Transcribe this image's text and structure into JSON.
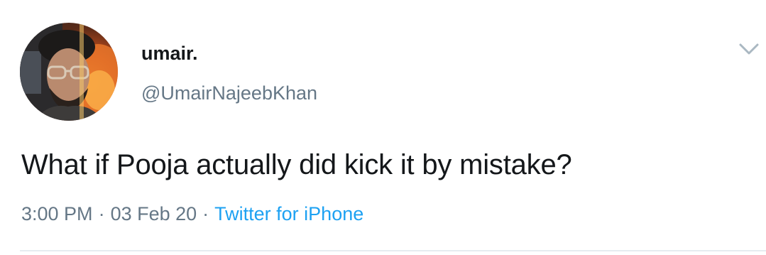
{
  "user": {
    "display_name": "umair.",
    "handle": "@UmairNajeebKhan",
    "avatar_icon": "profile-photo"
  },
  "tweet": {
    "text": "What if Pooja actually did kick it by mistake?",
    "time": "3:00 PM",
    "separator": "·",
    "date": "03 Feb 20",
    "source": "Twitter for iPhone"
  },
  "menu": {
    "icon": "chevron-down-icon"
  },
  "colors": {
    "text": "#14171a",
    "secondary": "#657786",
    "link": "#1da1f2",
    "divider": "#e6ecf0"
  }
}
